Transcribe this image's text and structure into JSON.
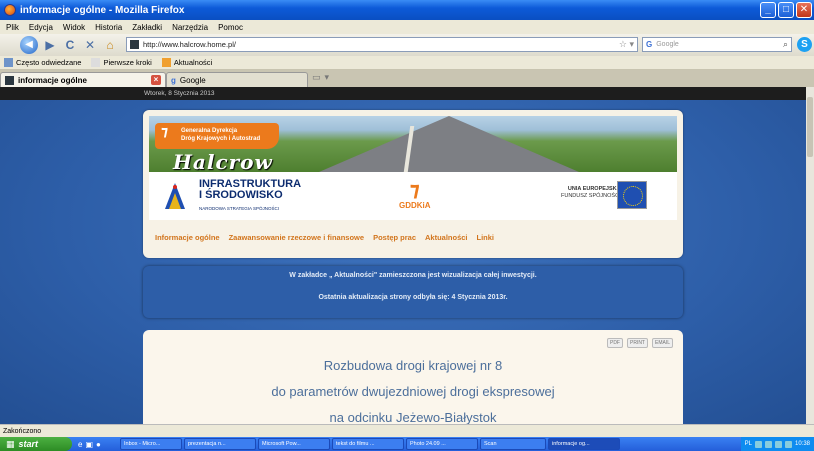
{
  "window": {
    "title": "informacje ogólne - Mozilla Firefox",
    "buttons": [
      "_",
      "□",
      "✕"
    ]
  },
  "menu": {
    "items": [
      "Plik",
      "Edycja",
      "Widok",
      "Historia",
      "Zakładki",
      "Narzędzia",
      "Pomoc"
    ]
  },
  "nav": {
    "back": "◀",
    "forward": "▶",
    "reload": "C",
    "stop": "✕",
    "home": "⌂",
    "url": "http://www.halcrow.home.pl/",
    "search_placeholder": "Google",
    "search_engine": "G"
  },
  "bookmarks": {
    "items": [
      "Często odwiedzane",
      "Pierwsze kroki",
      "Aktualności"
    ]
  },
  "tabs": {
    "active_label": "informacje ogólne",
    "second_label": "Google"
  },
  "page": {
    "date": "Wtorek, 8 Stycznia 2013",
    "gddkia_line1": "Generalna Dyrekcja",
    "gddkia_line2": "Dróg Krajowych i Autostrad",
    "halcrow": "Halcrow",
    "infra_line1": "INFRASTRUKTURA",
    "infra_line2": "I ŚRODOWISKO",
    "infra_sub": "NARODOWA STRATEGIA SPÓJNOŚCI",
    "gddkia_logo": "GDDKiA",
    "ue_line1": "UNIA EUROPEJSKA",
    "ue_line2": "FUNDUSZ SPÓJNOŚCI",
    "nav": [
      "Informacje ogólne",
      "Zaawansowanie rzeczowe i finansowe",
      "Postęp prac",
      "Aktualności",
      "Linki"
    ],
    "notice_line1": "W zakładce „ Aktualności\" zamieszczona jest wizualizacja całej inwestycji.",
    "notice_line2": "Ostatnia aktualizacja strony odbyła się: 4 Stycznia 2013r.",
    "doc_icons": [
      "PDF",
      "PRINT",
      "EMAIL"
    ],
    "title_lines": [
      "Rozbudowa drogi krajowej nr 8",
      "do parametrów dwujezdniowej drogi ekspresowej",
      "na odcinku Jeżewo-Białystok"
    ]
  },
  "status": {
    "text": "Zakończono"
  },
  "taskbar": {
    "start": "start",
    "tasks": [
      "Inbox - Micro...",
      "prezentacja n...",
      "Microsoft Pow...",
      "tekst do filmu ...",
      "Photo 24.09 ...",
      "Scan",
      "informacje og..."
    ],
    "clock": "10:38",
    "lang": "PL"
  }
}
